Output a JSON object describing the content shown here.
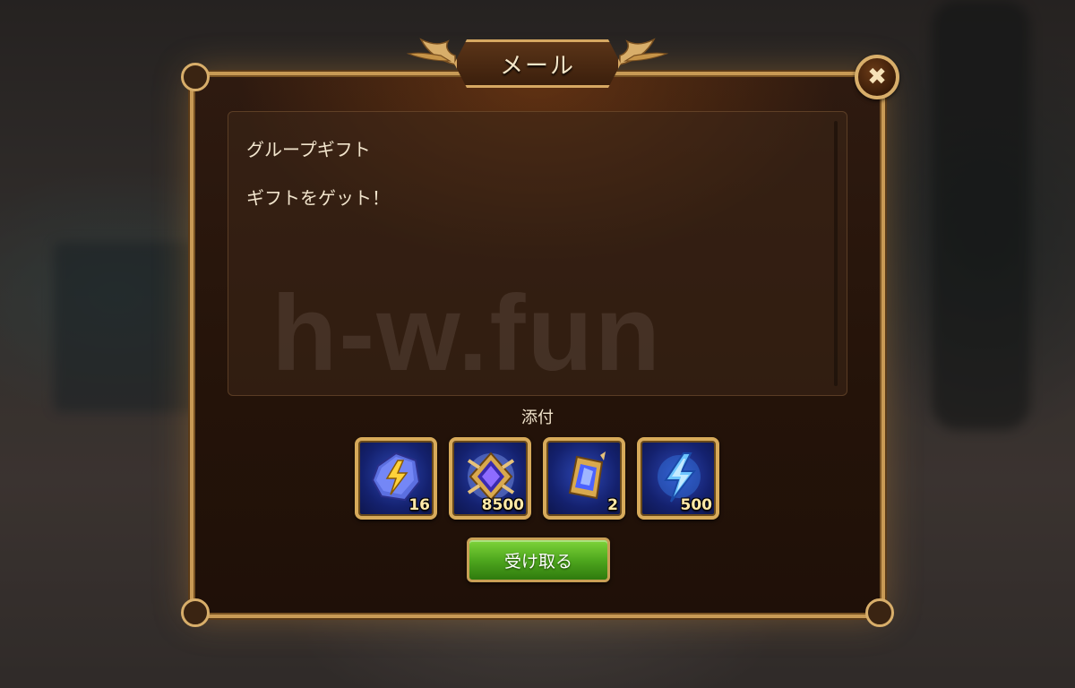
{
  "dialog": {
    "title": "メール",
    "close_icon": "close-x-icon"
  },
  "message": {
    "subject": "グループギフト",
    "body": "ギフトをゲット！"
  },
  "watermark": "h-w.fun",
  "attachments": {
    "label": "添付",
    "items": [
      {
        "icon": "lightning-stone-icon",
        "quantity": "16"
      },
      {
        "icon": "emblem-gem-icon",
        "quantity": "8500"
      },
      {
        "icon": "blue-crystal-icon",
        "quantity": "2"
      },
      {
        "icon": "energy-bolt-icon",
        "quantity": "500"
      }
    ]
  },
  "actions": {
    "receive_label": "受け取る"
  },
  "colors": {
    "frame_gold": "#c89a55",
    "button_green": "#4fa81e",
    "item_blue": "#2d47b5"
  }
}
